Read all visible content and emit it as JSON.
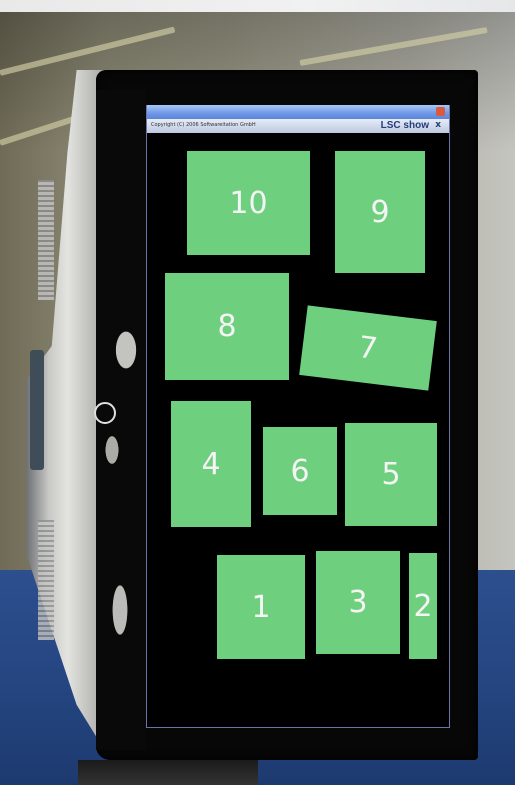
{
  "window": {
    "title": "",
    "menu_text": "Copyright (C) 2006 Softwareitation GmbH",
    "brand": "LSC show",
    "close_glyph": "x"
  },
  "tiles": [
    {
      "id": "10",
      "label": "10"
    },
    {
      "id": "9",
      "label": "9"
    },
    {
      "id": "8",
      "label": "8"
    },
    {
      "id": "7",
      "label": "7"
    },
    {
      "id": "4",
      "label": "4"
    },
    {
      "id": "6",
      "label": "6"
    },
    {
      "id": "5",
      "label": "5"
    },
    {
      "id": "1",
      "label": "1"
    },
    {
      "id": "3",
      "label": "3"
    },
    {
      "id": "2",
      "label": "2"
    }
  ],
  "colors": {
    "tile": "#6ed07f",
    "screen": "#000000",
    "floor": "#244580"
  }
}
